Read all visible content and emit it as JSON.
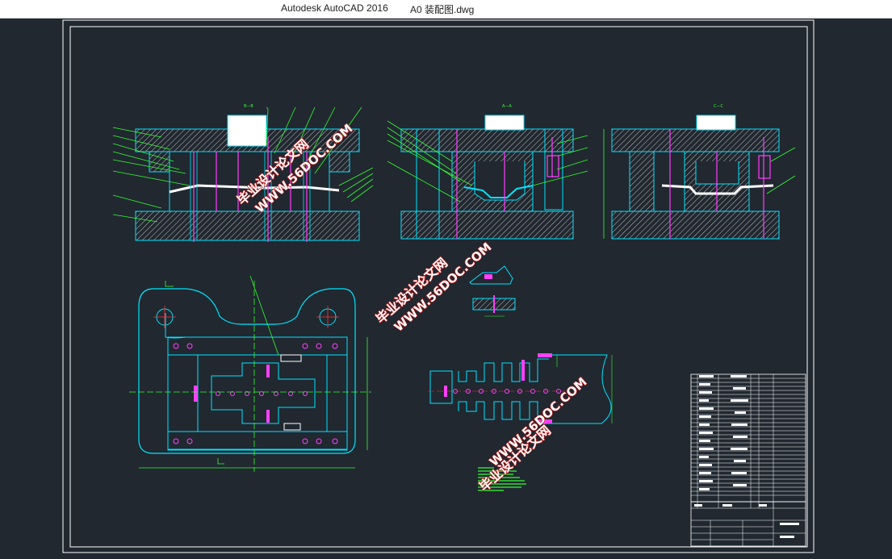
{
  "window": {
    "app_title": "Autodesk AutoCAD 2016",
    "file_name": "A0 装配图.dwg"
  },
  "drawing": {
    "section_labels": [
      "B—B",
      "A—A",
      "C—C"
    ],
    "watermark_cn": "毕业设计论文网",
    "watermark_url": "WWW.56DOC.COM",
    "colors": {
      "background": "#212830",
      "outline": "#00e5ff",
      "hatch": "#cfcfcf",
      "leader": "#33ff33",
      "pin": "#ff40ff",
      "center": "#ff3333",
      "dim": "#33ff33",
      "watermark_fill": "#ffffff",
      "watermark_stroke": "#d21010"
    },
    "icons": [
      "watermark-stamp-icon"
    ]
  }
}
